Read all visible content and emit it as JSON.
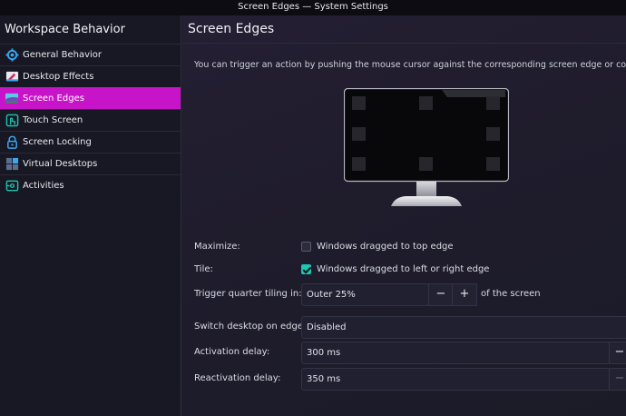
{
  "window": {
    "title": "Screen Edges — System Settings"
  },
  "sidebar": {
    "title": "Workspace Behavior",
    "items": [
      {
        "label": "General Behavior",
        "icon": "gear-icon"
      },
      {
        "label": "Desktop Effects",
        "icon": "desktop-effects-icon"
      },
      {
        "label": "Screen Edges",
        "icon": "screen-edges-icon",
        "active": true
      },
      {
        "label": "Touch Screen",
        "icon": "touch-icon"
      },
      {
        "label": "Screen Locking",
        "icon": "lock-icon"
      },
      {
        "label": "Virtual Desktops",
        "icon": "virtual-desktops-icon"
      },
      {
        "label": "Activities",
        "icon": "activities-icon"
      }
    ]
  },
  "main": {
    "title": "Screen Edges",
    "description": "You can trigger an action by pushing the mouse cursor against the corresponding screen edge or corner.",
    "maximize": {
      "label": "Maximize:",
      "checkbox_label": "Windows dragged to top edge",
      "checked": false
    },
    "tile": {
      "label": "Tile:",
      "checkbox_label": "Windows dragged to left or right edge",
      "checked": true
    },
    "quarter_tiling": {
      "label": "Trigger quarter tiling in:",
      "value": "Outer 25%",
      "minus": "−",
      "plus": "+",
      "suffix": "of the screen"
    },
    "switch_desktop": {
      "label": "Switch desktop on edge:",
      "value": "Disabled"
    },
    "activation_delay": {
      "label": "Activation delay:",
      "value": "300 ms"
    },
    "reactivation_delay": {
      "label": "Reactivation delay:",
      "value": "350 ms"
    }
  },
  "colors": {
    "accent": "#c814c8",
    "checkbox": "#1ec5b0"
  }
}
